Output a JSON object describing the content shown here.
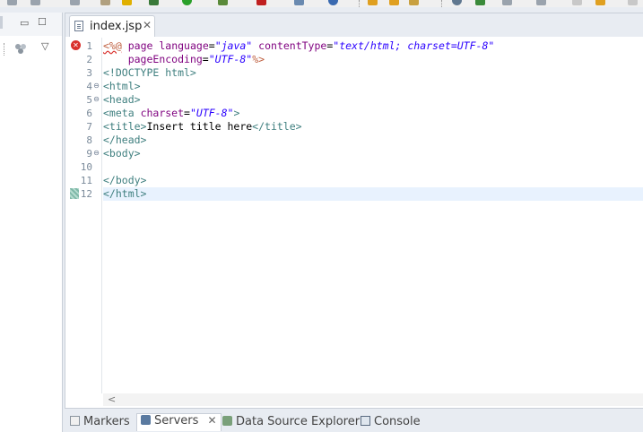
{
  "left_pane": {
    "minimize_glyph": "▭",
    "maximize_glyph": "☐",
    "menu_glyph": "▽"
  },
  "editor": {
    "tab": {
      "label": "index.jsp",
      "close": "✕"
    },
    "lines": [
      {
        "number": "1",
        "marker": "error",
        "fold": ""
      },
      {
        "number": "2",
        "marker": "",
        "fold": ""
      },
      {
        "number": "3",
        "marker": "",
        "fold": ""
      },
      {
        "number": "4",
        "marker": "",
        "fold": "⊖"
      },
      {
        "number": "5",
        "marker": "",
        "fold": "⊖"
      },
      {
        "number": "6",
        "marker": "",
        "fold": ""
      },
      {
        "number": "7",
        "marker": "",
        "fold": ""
      },
      {
        "number": "8",
        "marker": "",
        "fold": ""
      },
      {
        "number": "9",
        "marker": "",
        "fold": "⊖"
      },
      {
        "number": "10",
        "marker": "",
        "fold": ""
      },
      {
        "number": "11",
        "marker": "",
        "fold": ""
      },
      {
        "number": "12",
        "marker": "bookmark",
        "fold": ""
      }
    ],
    "code": {
      "l1": {
        "open": "<%@",
        "sp1": " ",
        "a1": "page",
        "sp2": " ",
        "a2": "language",
        "eq1": "=",
        "v1": "\"java\"",
        "sp3": " ",
        "a3": "contentType",
        "eq2": "=",
        "v2": "\"text/html; charset=UTF-8\""
      },
      "l2": {
        "indent": "    ",
        "a1": "pageEncoding",
        "eq1": "=",
        "v1": "\"UTF-8\"",
        "close": "%>"
      },
      "l3": "<!DOCTYPE html>",
      "l4": "<html>",
      "l5": "<head>",
      "l6": {
        "tag": "<meta",
        "sp": " ",
        "attr": "charset",
        "eq": "=",
        "val": "\"UTF-8\"",
        "close": ">"
      },
      "l7": {
        "open": "<title>",
        "text": "Insert title here",
        "close": "</title>"
      },
      "l8": "</head>",
      "l9": "<body>",
      "l10": "",
      "l11": "</body>",
      "l12": "</html>"
    },
    "current_line": 12,
    "scroll_left_glyph": "<"
  },
  "bottom_tabs": [
    {
      "label": "Markers",
      "active": false
    },
    {
      "label": "Servers",
      "active": true,
      "close": "✕"
    },
    {
      "label": "Data Source Explorer",
      "active": false
    },
    {
      "label": "Console",
      "active": false
    }
  ],
  "colors": {
    "tag": "#3f7f7f",
    "attribute": "#7f007f",
    "string": "#2a00ff",
    "jsp_delimiter": "#bf5f3f",
    "error": "#d9302c",
    "current_line": "#e8f2fe"
  }
}
